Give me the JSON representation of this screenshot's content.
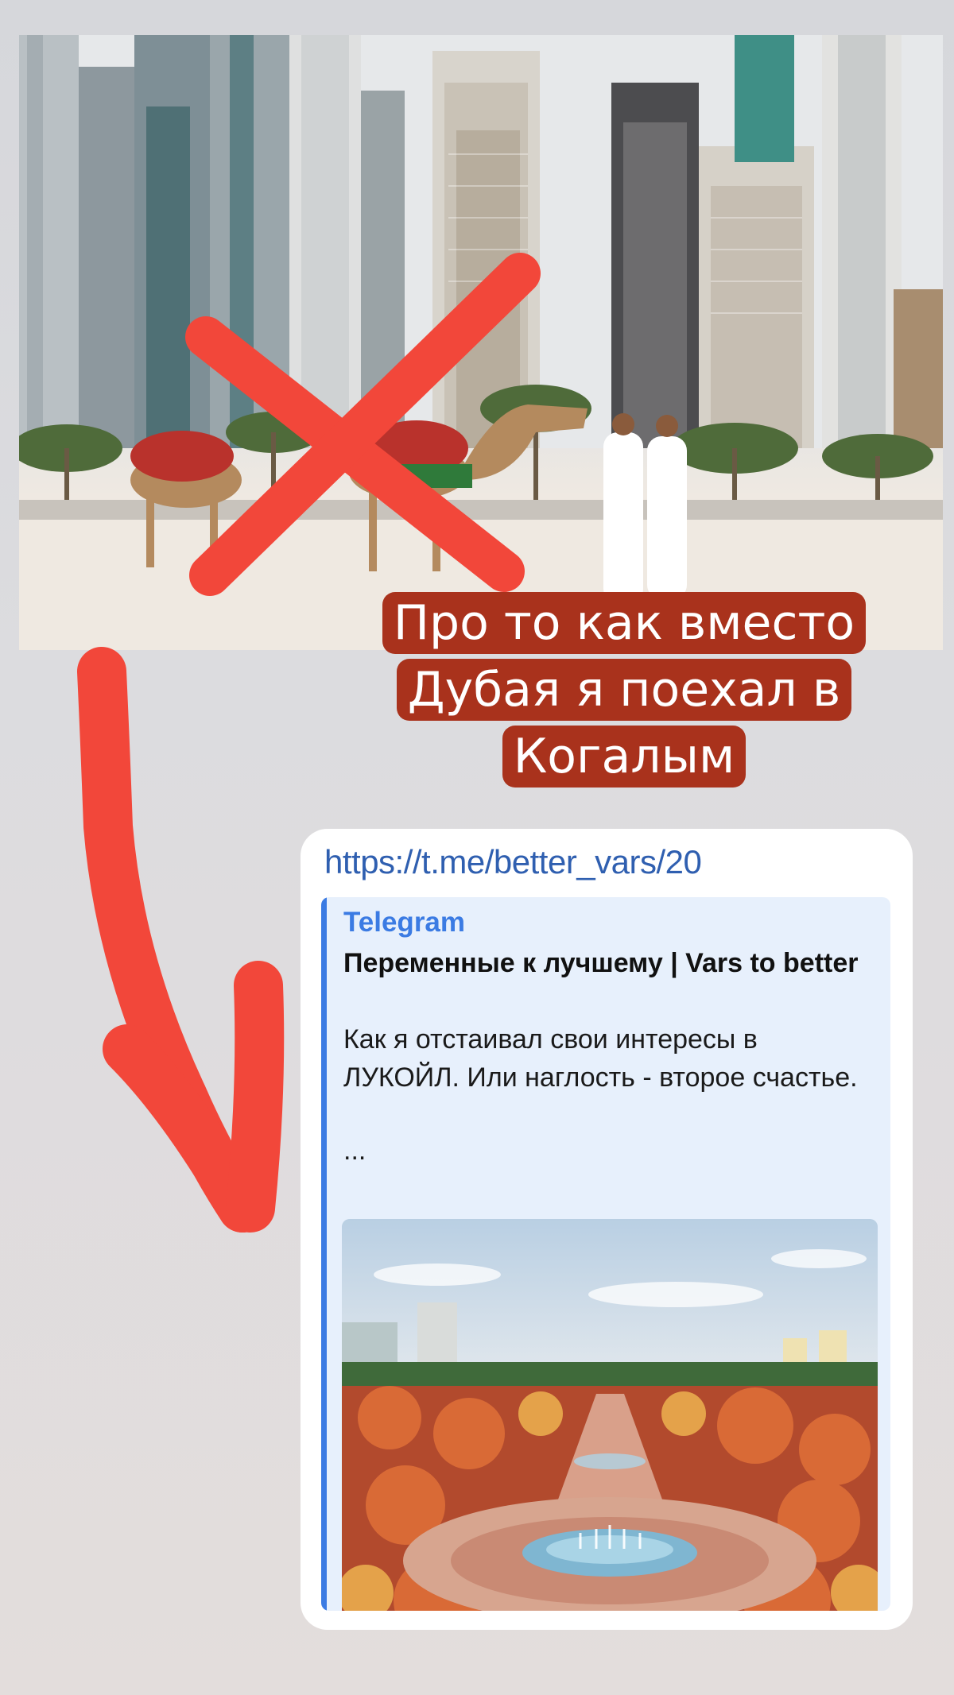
{
  "story": {
    "title_lines": [
      "Про то как вместо",
      "Дубая я поехал в",
      "Когалым"
    ]
  },
  "message": {
    "link": "https://t.me/better_vars/20",
    "preview": {
      "site_name": "Telegram",
      "title": "Переменные к лучшему | Vars to better",
      "description": "Как я отстаивал свои интересы в ЛУКОЙЛ. Или наглость - второе счастье.",
      "ellipsis": "..."
    }
  },
  "colors": {
    "title_bg": "#a9321c",
    "strike": "#f2473a",
    "link": "#2f5fb0",
    "preview_accent": "#3b7be3",
    "preview_bg": "#e7f0fc"
  },
  "icons": [
    "cross-mark-icon",
    "hand-drawn-arrow-icon"
  ]
}
